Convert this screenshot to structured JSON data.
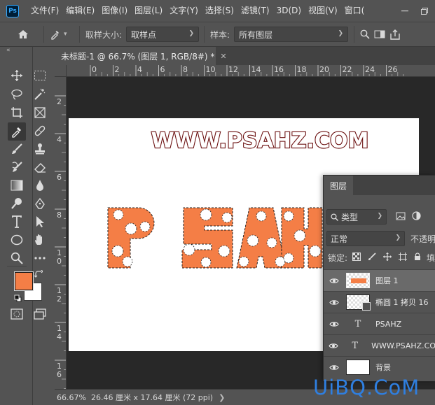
{
  "menubar": {
    "items": [
      "文件(F)",
      "编辑(E)",
      "图像(I)",
      "图层(L)",
      "文字(Y)",
      "选择(S)",
      "滤镜(T)",
      "3D(D)",
      "视图(V)",
      "窗口("
    ],
    "logo": "Ps"
  },
  "options": {
    "sample_size_label": "取样大小:",
    "sample_size_value": "取样点",
    "sample_label": "样本:",
    "sample_value": "所有图层"
  },
  "document": {
    "tab_title": "未标题-1 @ 66.7% (图层 1, RGB/8#) *",
    "canvas_headline": "WWW.PSAHZ.COM",
    "canvas_big_text": "PSAHZ",
    "text_color": "#f47e46",
    "outline_color": "#6b1010"
  },
  "ruler": {
    "h_ticks": [
      "0",
      "2",
      "4",
      "6",
      "8",
      "10",
      "12",
      "14",
      "16",
      "18",
      "20",
      "22",
      "24",
      "26"
    ],
    "v_ticks": [
      "2",
      "4",
      "6",
      "8",
      "1\n0",
      "1\n2",
      "1\n4",
      "1\n6"
    ]
  },
  "status": {
    "zoom": "66.67%",
    "doc_size": "26.46 厘米 x 17.64 厘米 (72 ppi)"
  },
  "colors": {
    "foreground": "#f47e46",
    "background": "#ffffff"
  },
  "layers_panel": {
    "tab": "图层",
    "filter_label": "类型",
    "blend_mode": "正常",
    "opacity_label": "不透明",
    "lock_label": "锁定:",
    "fill_label": "填",
    "layers": [
      {
        "name": "图层 1",
        "type": "pixel",
        "selected": true
      },
      {
        "name": "椭圆 1 拷贝 16",
        "type": "shape",
        "selected": false
      },
      {
        "name": "PSAHZ",
        "type": "text",
        "selected": false
      },
      {
        "name": "WWW.PSAHZ.CO",
        "type": "text",
        "selected": false
      },
      {
        "name": "背景",
        "type": "background",
        "selected": false
      }
    ]
  },
  "watermark": "UiBQ.CoM"
}
